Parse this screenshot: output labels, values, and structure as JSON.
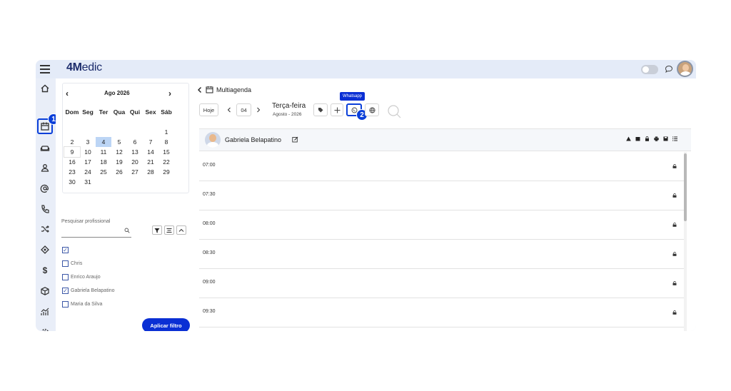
{
  "app": {
    "logo_prefix": "4M",
    "logo_rest": "edic"
  },
  "annotations": {
    "badge1": "1",
    "badge2": "2"
  },
  "calendar": {
    "prev": "‹",
    "next": "›",
    "title": "Ago  2026",
    "weekdays": [
      "Dom",
      "Seg",
      "Ter",
      "Qua",
      "Qui",
      "Sex",
      "Sáb"
    ],
    "weeks": [
      [
        "",
        "",
        "",
        "",
        "",
        "",
        "1"
      ],
      [
        "2",
        "3",
        "4",
        "5",
        "6",
        "7",
        "8"
      ],
      [
        "9",
        "10",
        "11",
        "12",
        "13",
        "14",
        "15"
      ],
      [
        "16",
        "17",
        "18",
        "19",
        "20",
        "21",
        "22"
      ],
      [
        "23",
        "24",
        "25",
        "26",
        "27",
        "28",
        "29"
      ],
      [
        "30",
        "31",
        "",
        "",
        "",
        "",
        ""
      ]
    ],
    "selected_day": "4"
  },
  "filters": {
    "search_label": "Pesquisar profissional",
    "professionals": [
      {
        "name": "",
        "checked": true
      },
      {
        "name": "Chris",
        "checked": false
      },
      {
        "name": "Enrico Araujo",
        "checked": false
      },
      {
        "name": "Gabriela Belapatino",
        "checked": true
      },
      {
        "name": "Maria da Silva",
        "checked": false
      }
    ],
    "apply_label": "Aplicar filtro"
  },
  "main": {
    "title": "Multiagenda",
    "today_label": "Hoje",
    "date_value": "04",
    "day_title": "Terça-feira",
    "day_subtitle": "Agosto - 2026",
    "whatsapp_tooltip": "Whatsapp"
  },
  "professional": {
    "name": "Gabriela Belapatino"
  },
  "slots": [
    "07:00",
    "07:30",
    "08:00",
    "08:30",
    "09:00",
    "09:30"
  ],
  "colors": {
    "accent": "#0a2fd4",
    "selected_day": "#bcd5f5",
    "sidebar_bg": "#e9eef8"
  }
}
